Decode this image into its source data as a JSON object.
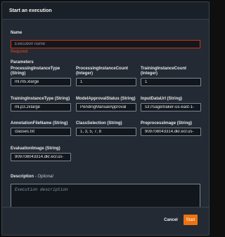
{
  "modal": {
    "title": "Start an execution"
  },
  "name_field": {
    "label": "Name",
    "placeholder": "Execution name",
    "value": "",
    "error": "Required"
  },
  "parameters": {
    "section_title": "Parameters",
    "items": [
      {
        "label": "ProcessingInstanceType (String)",
        "value": "ml.m5.xlarge"
      },
      {
        "label": "ProcessingInstanceCount (Integer)",
        "value": "1"
      },
      {
        "label": "TrainingInstanceCount (Integer)",
        "value": "1"
      },
      {
        "label": "TrainingInstanceType (String)",
        "value": "ml.p3.2xlarge"
      },
      {
        "label": "ModelApprovalStatus (String)",
        "value": "PendingManualApproval"
      },
      {
        "label": "InputDataUrl (String)",
        "value": "s3://sagemaker-us-east-1-"
      },
      {
        "label": "AnnotationFileName (String)",
        "value": "classes.txt"
      },
      {
        "label": "ClassSelection (String)",
        "value": "1, 3, 5, 7, 8"
      },
      {
        "label": "PreprocessImage (String)",
        "value": "909708043314.dkr.ecr.us-"
      },
      {
        "label": "EvaluationImage (String)",
        "value": "909708043314.dkr.ecr.us-"
      }
    ]
  },
  "description_field": {
    "label": "Description",
    "optional_suffix": " - Optional",
    "placeholder": "Execution description",
    "value": ""
  },
  "footer": {
    "cancel_label": "Cancel",
    "start_label": "Start"
  },
  "colors": {
    "primary_button": "#ec7211",
    "error": "#d13212",
    "background": "#232a33"
  }
}
